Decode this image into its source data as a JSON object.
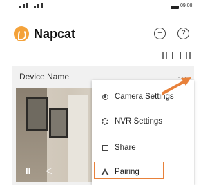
{
  "status_bar": {
    "time": "09:08"
  },
  "header": {
    "app_title": "Napcat",
    "add_icon": "plus-circle-icon",
    "help_icon": "question-circle-icon",
    "help_glyph": "?"
  },
  "toolbar": {
    "icons": [
      "sort-icon",
      "grid-view-icon",
      "filter-icon"
    ]
  },
  "device_card": {
    "name": "Device Name",
    "more": "···"
  },
  "video": {
    "play_glyph": "II",
    "volume_glyph": "◁"
  },
  "menu": {
    "items": [
      {
        "label": "Camera Settings",
        "icon": "camera-icon"
      },
      {
        "label": "NVR Settings",
        "icon": "gear-icon"
      },
      {
        "label": "Share",
        "icon": "share-icon"
      },
      {
        "label": "Pairing",
        "icon": "pairing-icon"
      }
    ],
    "highlight_color": "#e8813a"
  },
  "colors": {
    "brand": "#f4a23a",
    "arrow": "#e8813a"
  }
}
